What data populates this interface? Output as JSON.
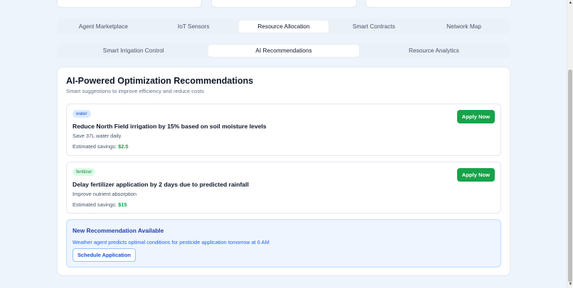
{
  "main_tabs": [
    {
      "label": "Agent Marketplace",
      "active": false
    },
    {
      "label": "IoT Sensors",
      "active": false
    },
    {
      "label": "Resource Allocation",
      "active": true
    },
    {
      "label": "Smart Contracts",
      "active": false
    },
    {
      "label": "Network Map",
      "active": false
    }
  ],
  "sub_tabs": [
    {
      "label": "Smart Irrigation Control",
      "active": false
    },
    {
      "label": "AI Recommendations",
      "active": true
    },
    {
      "label": "Resource Analytics",
      "active": false
    }
  ],
  "panel": {
    "title": "AI-Powered Optimization Recommendations",
    "subtitle": "Smart suggestions to improve efficiency and reduce costs"
  },
  "recommendations": [
    {
      "tag": "water",
      "title": "Reduce North Field irrigation by 15% based on soil moisture levels",
      "impact": "Save 37L water daily",
      "savings_label": "Estimated savings:",
      "savings_value": "$2.5",
      "button": "Apply Now"
    },
    {
      "tag": "fertilizer",
      "title": "Delay fertilizer application by 2 days due to predicted rainfall",
      "impact": "Improve nutrient absorption",
      "savings_label": "Estimated savings:",
      "savings_value": "$15",
      "button": "Apply Now"
    }
  ],
  "alert": {
    "title": "New Recommendation Available",
    "text": "Weather agent predicts optimal conditions for pesticide application tomorrow at 6 AM",
    "button": "Schedule Application"
  },
  "icons": {
    "scroll_up": "caret-up-icon",
    "scroll_down": "caret-down-icon"
  },
  "colors": {
    "accent_green": "#16a34a",
    "accent_blue": "#2563eb",
    "background": "#eef4fb"
  }
}
